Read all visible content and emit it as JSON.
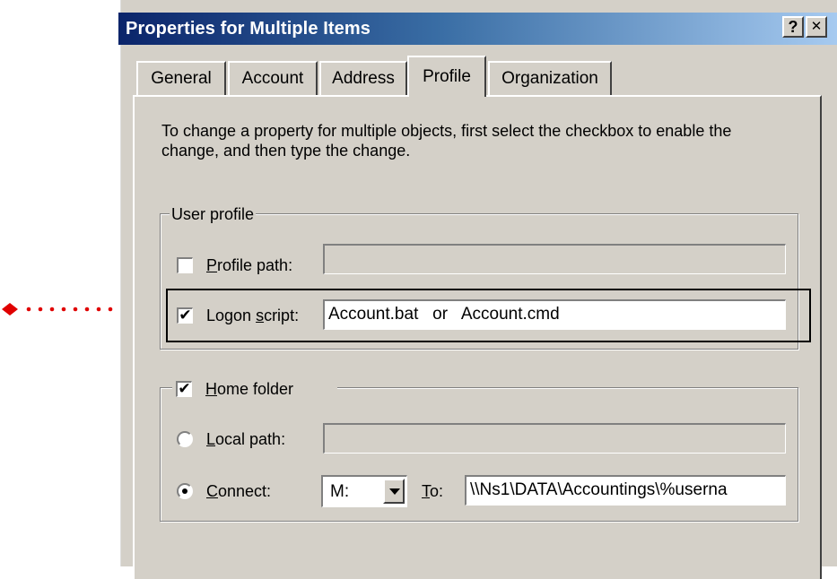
{
  "window": {
    "title": "Properties for Multiple Items",
    "help": "?",
    "close": "✕"
  },
  "tabs": [
    {
      "label": "General"
    },
    {
      "label": "Account"
    },
    {
      "label": "Address"
    },
    {
      "label": "Profile",
      "selected": true
    },
    {
      "label": "Organization"
    }
  ],
  "instructions": "To change a property for multiple objects, first select the checkbox to enable the change, and then type the change.",
  "user_profile": {
    "group_label": "User profile",
    "profile_path": {
      "label_u": "P",
      "label_rest": "rofile path:",
      "checked": false,
      "value": ""
    },
    "logon_script": {
      "label_pre": "Logon ",
      "label_u": "s",
      "label_post": "cript:",
      "checked": true,
      "value": "Account.bat   or   Account.cmd"
    }
  },
  "home_folder": {
    "label_u": "H",
    "label_rest": "ome folder",
    "checked": true,
    "local_path": {
      "label_u": "L",
      "label_rest": "ocal path:",
      "selected": false,
      "value": ""
    },
    "connect": {
      "label_u": "C",
      "label_rest": "onnect:",
      "selected": true,
      "drive": "M:",
      "to_u": "T",
      "to_rest": "o:",
      "value": "\\\\Ns1\\DATA\\Accountings\\%userna"
    }
  },
  "annotation_color": "#e00000",
  "checkmark": "✔"
}
